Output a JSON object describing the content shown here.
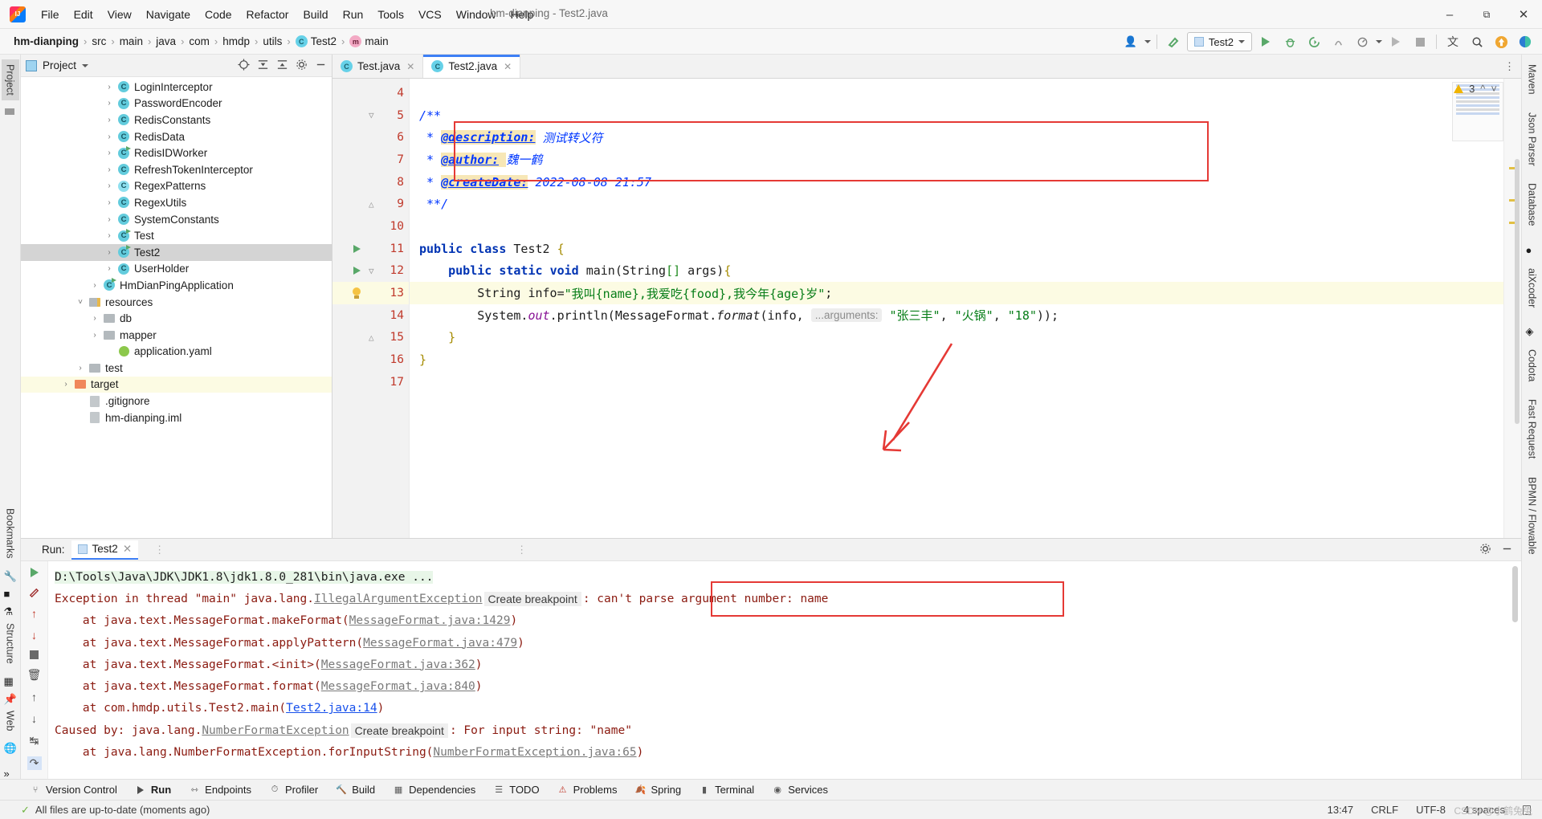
{
  "window": {
    "title": "hm-dianping - Test2.java",
    "controls": {
      "minimize": "–",
      "maximize": "❐",
      "close": "✕"
    }
  },
  "menu": [
    {
      "label": "File"
    },
    {
      "label": "Edit"
    },
    {
      "label": "View"
    },
    {
      "label": "Navigate"
    },
    {
      "label": "Code"
    },
    {
      "label": "Refactor"
    },
    {
      "label": "Build"
    },
    {
      "label": "Run"
    },
    {
      "label": "Tools"
    },
    {
      "label": "VCS"
    },
    {
      "label": "Window"
    },
    {
      "label": "Help"
    }
  ],
  "breadcrumb": [
    {
      "label": "hm-dianping",
      "icon": "none"
    },
    {
      "label": "src",
      "icon": "none"
    },
    {
      "label": "main",
      "icon": "none"
    },
    {
      "label": "java",
      "icon": "none"
    },
    {
      "label": "com",
      "icon": "none"
    },
    {
      "label": "hmdp",
      "icon": "none"
    },
    {
      "label": "utils",
      "icon": "none"
    },
    {
      "label": "Test2",
      "icon": "class-icon"
    },
    {
      "label": "main",
      "icon": "method-icon"
    }
  ],
  "toolbar": {
    "run_config": "Test2",
    "profile_icon": "user-profile-icon",
    "build_icon": "hammer-icon",
    "run_icon": "run-icon",
    "debug_icon": "debug-icon",
    "run_coverage_icon": "run-with-coverage-icon",
    "profiler_icon": "profiler-icon",
    "attach_icon": "attach-icon",
    "rerun_icon": "rerun-icon",
    "stop_icon": "stop-icon",
    "translate_icon": "translate-icon",
    "search_icon": "search-icon",
    "update_icon": "update-icon",
    "ai_icon": "ai-assistant-icon"
  },
  "left_rail": {
    "tabs": [
      "Project",
      "Bookmarks",
      "Structure",
      "Web"
    ]
  },
  "right_rail": {
    "tabs": [
      "Maven",
      "Json Parser",
      "Database",
      "aiXcoder",
      "Codota",
      "Fast Request",
      "BPMN / Flowable"
    ]
  },
  "project_panel": {
    "title": "Project",
    "actions": [
      "locate-icon",
      "expand-all-icon",
      "collapse-all-icon",
      "settings-icon",
      "hide-icon"
    ],
    "tree": [
      {
        "label": "LoginInterceptor",
        "indent": 5,
        "arrow": ">",
        "icon": "class-icon",
        "state": "normal"
      },
      {
        "label": "PasswordEncoder",
        "indent": 5,
        "arrow": ">",
        "icon": "class-icon",
        "state": "normal"
      },
      {
        "label": "RedisConstants",
        "indent": 5,
        "arrow": ">",
        "icon": "class-icon",
        "state": "normal"
      },
      {
        "label": "RedisData",
        "indent": 5,
        "arrow": ">",
        "icon": "class-icon",
        "state": "normal"
      },
      {
        "label": "RedisIDWorker",
        "indent": 5,
        "arrow": ">",
        "icon": "class-runnable-icon",
        "state": "normal"
      },
      {
        "label": "RefreshTokenInterceptor",
        "indent": 5,
        "arrow": ">",
        "icon": "class-icon",
        "state": "normal"
      },
      {
        "label": "RegexPatterns",
        "indent": 5,
        "arrow": ">",
        "icon": "interface-icon",
        "state": "normal"
      },
      {
        "label": "RegexUtils",
        "indent": 5,
        "arrow": ">",
        "icon": "class-icon",
        "state": "normal"
      },
      {
        "label": "SystemConstants",
        "indent": 5,
        "arrow": ">",
        "icon": "class-icon",
        "state": "normal"
      },
      {
        "label": "Test",
        "indent": 5,
        "arrow": ">",
        "icon": "class-runnable-icon",
        "state": "normal"
      },
      {
        "label": "Test2",
        "indent": 5,
        "arrow": ">",
        "icon": "class-runnable-icon",
        "state": "selected"
      },
      {
        "label": "UserHolder",
        "indent": 5,
        "arrow": ">",
        "icon": "class-icon",
        "state": "normal"
      },
      {
        "label": "HmDianPingApplication",
        "indent": 4,
        "arrow": ">",
        "icon": "spring-class-icon",
        "state": "normal"
      },
      {
        "label": "resources",
        "indent": 3,
        "arrow": "v",
        "icon": "resources-folder-icon",
        "state": "normal"
      },
      {
        "label": "db",
        "indent": 4,
        "arrow": ">",
        "icon": "folder-icon",
        "state": "normal"
      },
      {
        "label": "mapper",
        "indent": 4,
        "arrow": ">",
        "icon": "folder-icon",
        "state": "normal"
      },
      {
        "label": "application.yaml",
        "indent": 5,
        "arrow": "",
        "icon": "yaml-icon",
        "state": "normal"
      },
      {
        "label": "test",
        "indent": 3,
        "arrow": ">",
        "icon": "folder-icon",
        "state": "normal"
      },
      {
        "label": "target",
        "indent": 2,
        "arrow": ">",
        "icon": "folder-orange-icon",
        "state": "highlight"
      },
      {
        "label": ".gitignore",
        "indent": 3,
        "arrow": "",
        "icon": "file-icon",
        "state": "normal"
      },
      {
        "label": "hm-dianping.iml",
        "indent": 3,
        "arrow": "",
        "icon": "file-icon",
        "state": "normal"
      }
    ]
  },
  "editor": {
    "tabs": [
      {
        "label": "Test.java",
        "icon": "java-class-icon",
        "active": false
      },
      {
        "label": "Test2.java",
        "icon": "java-class-icon",
        "active": true
      }
    ],
    "inspection": {
      "count": "3",
      "icon": "warning-icon",
      "up": "⌃",
      "down": "⌄"
    },
    "lines": [
      {
        "num": "4",
        "text": ""
      },
      {
        "num": "5",
        "text": "/**"
      },
      {
        "num": "6",
        "text": " * @description: 测试转义符"
      },
      {
        "num": "7",
        "text": " * @author: 魏一鹤"
      },
      {
        "num": "8",
        "text": " * @createDate: 2022-08-08 21:57"
      },
      {
        "num": "9",
        "text": " **/"
      },
      {
        "num": "10",
        "text": ""
      },
      {
        "num": "11",
        "text": "public class Test2 {"
      },
      {
        "num": "12",
        "text": "    public static void main(String[] args){"
      },
      {
        "num": "13",
        "text": "        String info=\"我叫{name},我爱吃{food},我今年{age}岁\";"
      },
      {
        "num": "14",
        "text": "        System.out.println(MessageFormat.format(info, \"张三丰\", \"火锅\", \"18\"));"
      },
      {
        "num": "15",
        "text": "    }"
      },
      {
        "num": "16",
        "text": "}"
      },
      {
        "num": "17",
        "text": ""
      }
    ],
    "code_tokens": {
      "l6_tag": "@description:",
      "l6_val": "测试转义符",
      "l7_tag": "@author:",
      "l7_val": "魏一鹤",
      "l8_tag": "@createDate:",
      "l8_val": "2022-08-08 21:57",
      "hint_arguments": "...arguments:",
      "l13_string": "\"我叫{name},我爱吃{food},我今年{age}岁\"",
      "arg1": "\"张三丰\"",
      "arg2": "\"火锅\"",
      "arg3": "\"18\""
    }
  },
  "run_panel": {
    "label": "Run:",
    "tab": "Test2",
    "toolbar_icons": [
      "rerun-icon",
      "stop-icon",
      "resume-icon",
      "step-icon",
      "up-icon",
      "down-icon",
      "soft-wrap-icon",
      "scroll-end-icon",
      "print-icon",
      "clear-icon"
    ],
    "console": [
      {
        "type": "cmd",
        "text": "D:\\Tools\\Java\\JDK\\JDK1.8\\jdk1.8.0_281\\bin\\java.exe ..."
      },
      {
        "type": "error",
        "text": "Exception in thread \"main\" java.lang.IllegalArgumentException: can't parse argument number: name"
      },
      {
        "type": "trace",
        "text": "    at java.text.MessageFormat.makeFormat(MessageFormat.java:1429)"
      },
      {
        "type": "trace",
        "text": "    at java.text.MessageFormat.applyPattern(MessageFormat.java:479)"
      },
      {
        "type": "trace",
        "text": "    at java.text.MessageFormat.<init>(MessageFormat.java:362)"
      },
      {
        "type": "trace",
        "text": "    at java.text.MessageFormat.format(MessageFormat.java:840)"
      },
      {
        "type": "trace",
        "text": "    at com.hmdp.utils.Test2.main(Test2.java:14)"
      },
      {
        "type": "error",
        "text": "Caused by: java.lang.NumberFormatException: For input string: \"name\""
      },
      {
        "type": "trace",
        "text": "    at java.lang.NumberFormatException.forInputString(NumberFormatException.java:65)"
      }
    ],
    "tokens": {
      "exception_prefix": "Exception in thread \"main\" java.lang.",
      "exception_class": "IllegalArgumentException",
      "create_breakpoint": "Create breakpoint",
      "exception_message": ": can't parse argument number: name",
      "caused_prefix": "Caused by: java.lang.",
      "caused_class": "NumberFormatException",
      "caused_message": ": For input string: \"name\"",
      "t1_pre": "    at java.text.MessageFormat.makeFormat(",
      "t1_lnk": "MessageFormat.java:1429",
      "t1_post": ")",
      "t2_pre": "    at java.text.MessageFormat.applyPattern(",
      "t2_lnk": "MessageFormat.java:479",
      "t2_post": ")",
      "t3_pre": "    at java.text.MessageFormat.<init>(",
      "t3_lnk": "MessageFormat.java:362",
      "t3_post": ")",
      "t4_pre": "    at java.text.MessageFormat.format(",
      "t4_lnk": "MessageFormat.java:840",
      "t4_post": ")",
      "t5_pre": "    at com.hmdp.utils.Test2.main(",
      "t5_lnk": "Test2.java:14",
      "t5_post": ")",
      "t6_pre": "    at java.lang.NumberFormatException.forInputString(",
      "t6_lnk": "NumberFormatException.java:65",
      "t6_post": ")"
    }
  },
  "bottom_bar": [
    {
      "label": "Version Control",
      "icon": "branch-icon"
    },
    {
      "label": "Run",
      "icon": "run-icon"
    },
    {
      "label": "Endpoints",
      "icon": "endpoints-icon"
    },
    {
      "label": "Profiler",
      "icon": "profiler-icon"
    },
    {
      "label": "Build",
      "icon": "hammer-icon"
    },
    {
      "label": "Dependencies",
      "icon": "dependencies-icon"
    },
    {
      "label": "TODO",
      "icon": "todo-icon"
    },
    {
      "label": "Problems",
      "icon": "problems-icon"
    },
    {
      "label": "Spring",
      "icon": "spring-icon"
    },
    {
      "label": "Terminal",
      "icon": "terminal-icon"
    },
    {
      "label": "Services",
      "icon": "services-icon"
    }
  ],
  "status_bar": {
    "message": "All files are up-to-date (moments ago)",
    "time": "13:47",
    "line_sep": "CRLF",
    "encoding": "UTF-8",
    "indent": "4 spaces",
    "lock_icon": "lock-icon",
    "watermark": "CSDN @小鹤兔兔"
  },
  "annotations": {
    "accent_red": "#e53935",
    "arrow_name": "red-pointer-arrow"
  }
}
